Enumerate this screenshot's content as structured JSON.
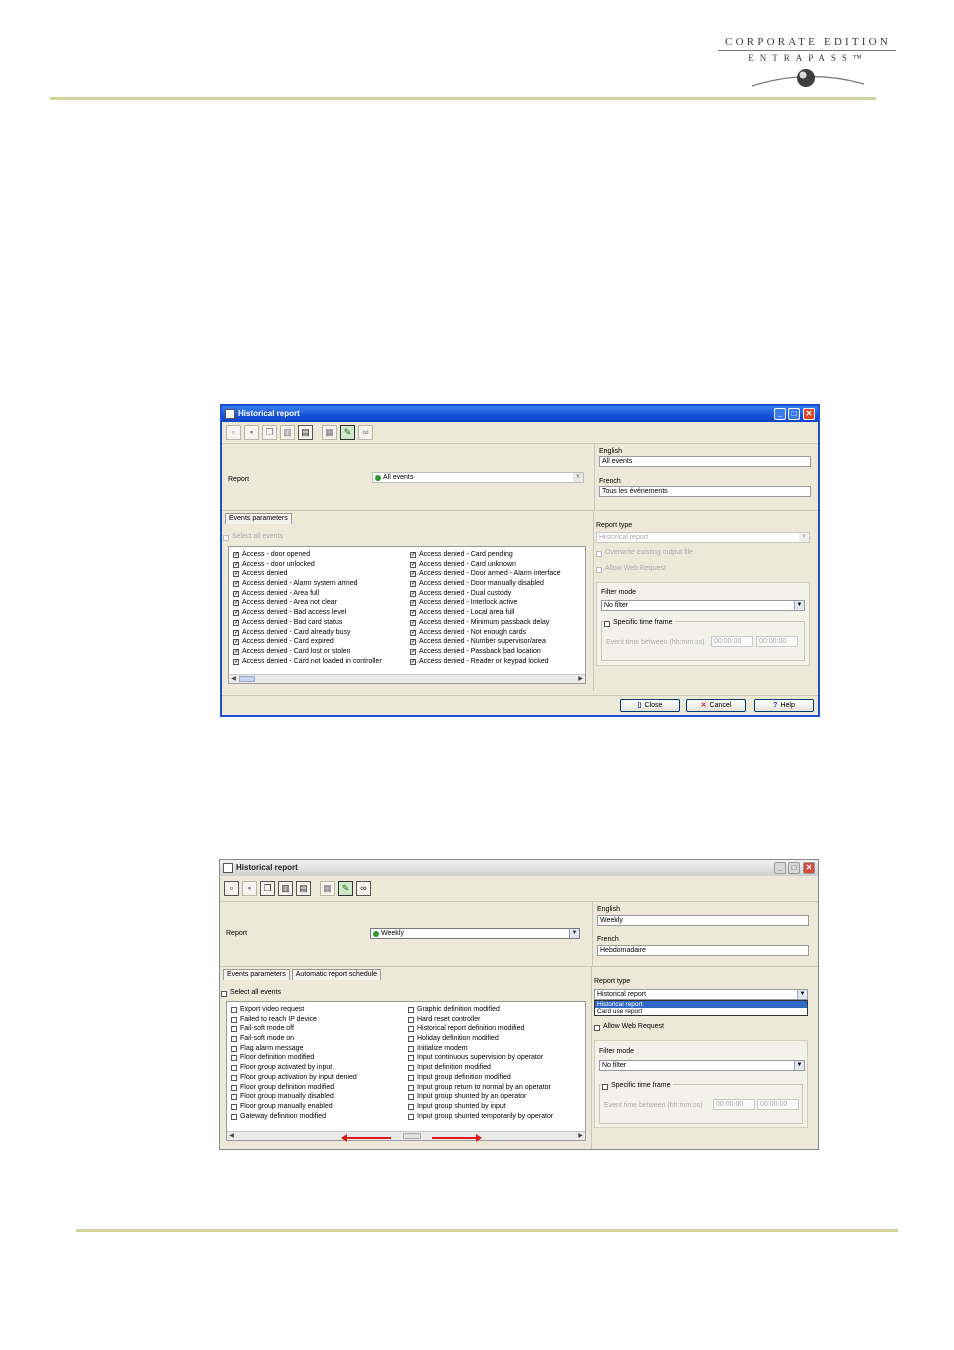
{
  "header": {
    "brand_line1": "CORPORATE EDITION",
    "brand_line2": "ENTRAPASS™",
    "accent_color": "#d6d29c"
  },
  "window1": {
    "title": "Historical report",
    "report_label": "Report",
    "report_value": "All events",
    "english_label": "English",
    "english_value": "All events",
    "french_label": "French",
    "french_value": "Tous les événements",
    "tabs": [
      "Events parameters"
    ],
    "select_all_label": "Select all events",
    "events_col1": [
      "Access - door opened",
      "Access - door unlocked",
      "Access denied",
      "Access denied - Alarm system armed",
      "Access denied - Area full",
      "Access denied - Area not clear",
      "Access denied - Bad access level",
      "Access denied - Bad card status",
      "Access denied - Card already busy",
      "Access denied - Card expired",
      "Access denied - Card lost or stolen",
      "Access denied - Card not loaded in controller"
    ],
    "events_col2": [
      "Access denied - Card pending",
      "Access denied - Card unknown",
      "Access denied - Door armed - Alarm interface",
      "Access denied - Door manually disabled",
      "Access denied - Dual custody",
      "Access denied - Interlock active",
      "Access denied - Local area full",
      "Access denied - Minimum passback delay",
      "Access denied - Not enough cards",
      "Access denied - Number supervisor/area",
      "Access denied - Passback bad location",
      "Access denied - Reader or keypad locked"
    ],
    "report_type_label": "Report type",
    "report_type_value": "Historical report",
    "overwrite_label": "Overwrite existing output file",
    "allow_web_label": "Allow Web Request",
    "filter_mode_label": "Filter mode",
    "filter_mode_value": "No filter",
    "specific_time_label": "Specific time frame",
    "event_time_label": "Event time between (hh:mm:ss)",
    "time_from": "00:00:00",
    "time_to": "00:00:00",
    "buttons": {
      "close": "Close",
      "cancel": "Cancel",
      "help": "Help"
    }
  },
  "window2": {
    "title": "Historical report",
    "report_label": "Report",
    "report_value": "Weekly",
    "english_label": "English",
    "english_value": "Weekly",
    "french_label": "French",
    "french_value": "Hebdomadaire",
    "tabs": [
      "Events parameters",
      "Automatic report schedule"
    ],
    "select_all_label": "Select all events",
    "events_col1": [
      "Export video request",
      "Failed to reach IP device",
      "Fail-soft mode off",
      "Fail-soft mode on",
      "Flag alarm message",
      "Floor definition modified",
      "Floor group activated by input",
      "Floor group activation by input denied",
      "Floor group definition modified",
      "Floor group manually disabled",
      "Floor group manually enabled",
      "Gateway definition modified"
    ],
    "events_col2": [
      "Graphic definition modified",
      "Hard reset controller",
      "Historical report definition modified",
      "Holiday definition modified",
      "Initialize modem",
      "Input continuous supervision by operator",
      "Input definition modified",
      "Input group definition modified",
      "Input group return to normal by an operator",
      "Input group shunted by an operator",
      "Input group shunted by input",
      "Input group shunted temporarily by operator"
    ],
    "report_type_label": "Report type",
    "report_type_value": "Historical report",
    "report_type_options": [
      "Historical report",
      "Card use report"
    ],
    "allow_web_label": "Allow Web Request",
    "filter_mode_label": "Filter mode",
    "filter_mode_value": "No filter",
    "specific_time_label": "Specific time frame",
    "event_time_label": "Event time between (hh:mm:ss)",
    "time_from": "00:00:00",
    "time_to": "00:00:00"
  }
}
